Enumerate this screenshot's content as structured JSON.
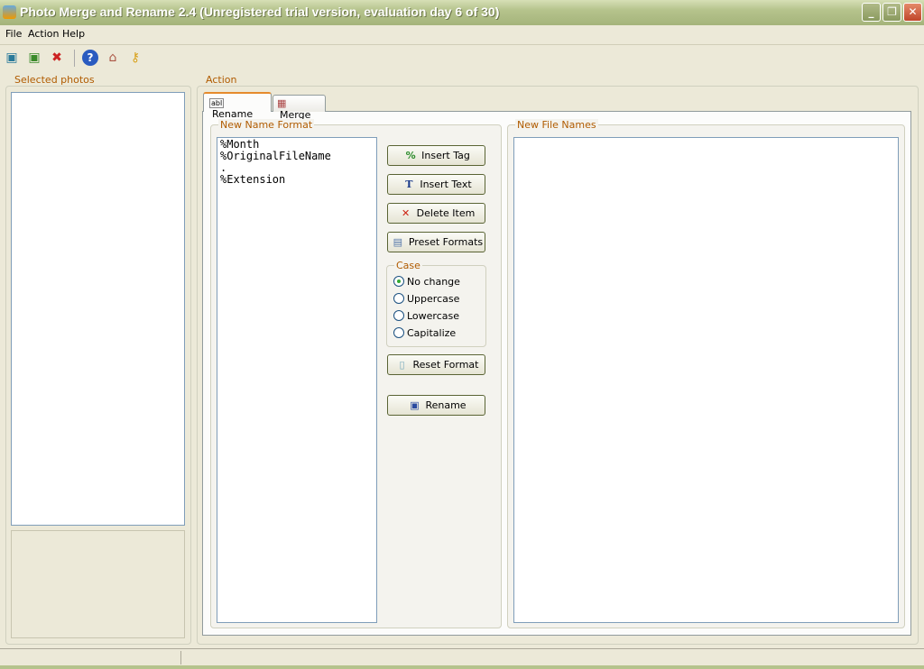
{
  "window": {
    "title": "Photo Merge and Rename 2.4 (Unregistered trial version, evaluation day 6 of 30)"
  },
  "menu": [
    "File",
    "Action",
    "Help"
  ],
  "toolbar": [
    "add-photos-icon",
    "add-folder-icon",
    "remove-photos-icon",
    "help-icon",
    "home-icon",
    "key-icon"
  ],
  "left": {
    "label": "Selected photos"
  },
  "action": {
    "label": "Action",
    "tabs": [
      "Rename",
      "Merge"
    ],
    "format_label": "New Name Format",
    "format_lines": [
      "%Month",
      "%OriginalFileName",
      ".",
      "%Extension"
    ],
    "buttons": {
      "insert_tag": "Insert Tag",
      "insert_text": "Insert Text",
      "delete_item": "Delete Item",
      "preset_formats": "Preset Formats",
      "reset_format": "Reset Format",
      "rename": "Rename"
    },
    "case": {
      "label": "Case",
      "options": [
        "No change",
        "Uppercase",
        "Lowercase",
        "Capitalize"
      ],
      "selected": "No change"
    },
    "names_label": "New File Names"
  }
}
